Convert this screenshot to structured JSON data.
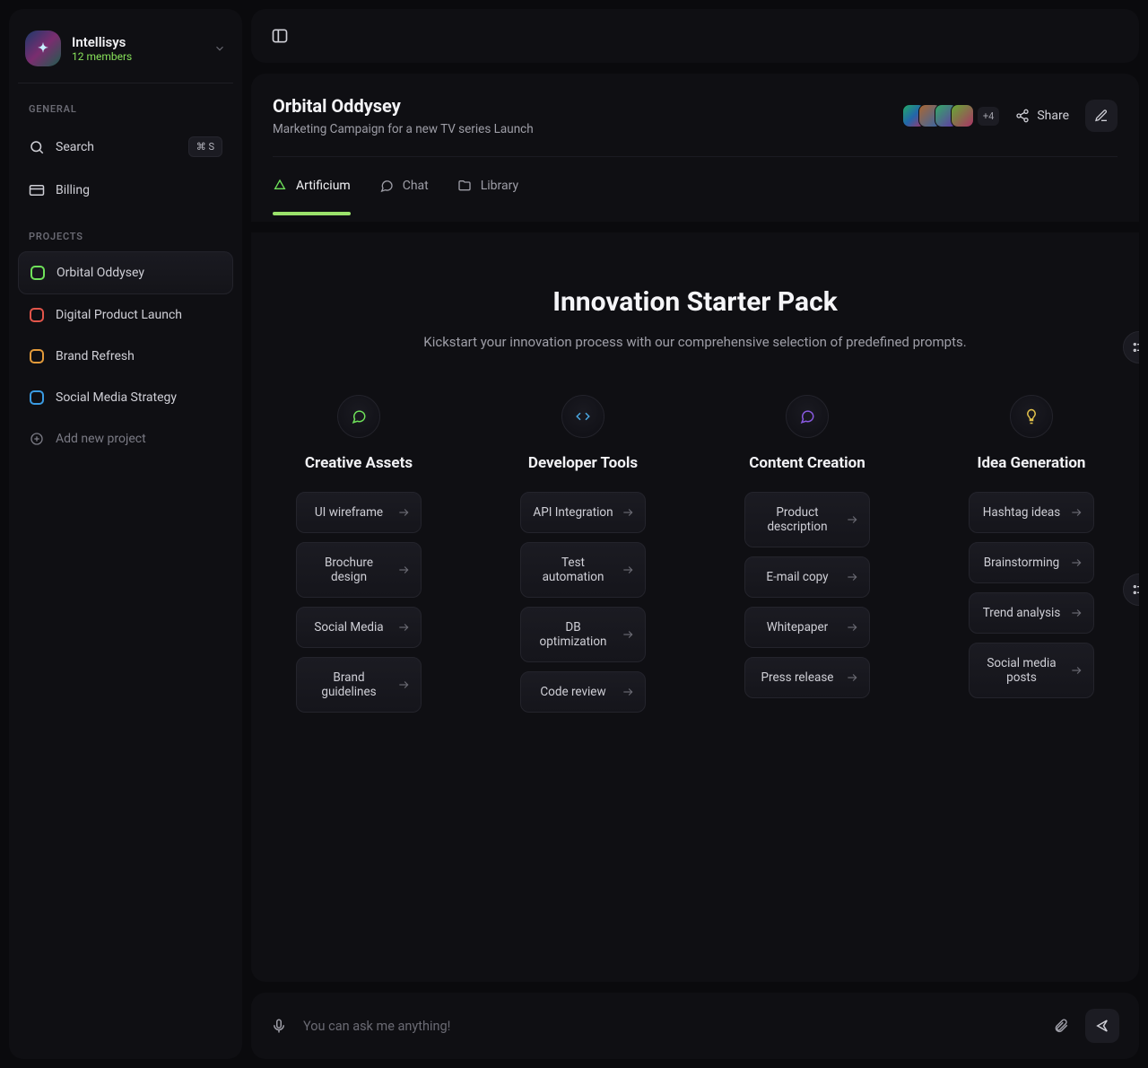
{
  "workspace": {
    "name": "Intellisys",
    "members": "12 members"
  },
  "sidebar": {
    "general_label": "GENERAL",
    "search": {
      "label": "Search",
      "shortcut": "⌘ S"
    },
    "billing": "Billing",
    "projects_label": "PROJECTS",
    "projects": [
      {
        "label": "Orbital Oddysey",
        "color": "#6fe25a",
        "active": true
      },
      {
        "label": "Digital Product Launch",
        "color": "#e2554a"
      },
      {
        "label": "Brand Refresh",
        "color": "#e29a3a"
      },
      {
        "label": "Social Media Strategy",
        "color": "#3a9be2"
      }
    ],
    "add_project": "Add new project"
  },
  "header": {
    "title": "Orbital Oddysey",
    "subtitle": "Marketing Campaign for a new TV series Launch",
    "extra_members": "+4",
    "share": "Share"
  },
  "tabs": [
    {
      "label": "Artificium",
      "active": true
    },
    {
      "label": "Chat"
    },
    {
      "label": "Library"
    }
  ],
  "hero": {
    "title": "Innovation Starter Pack",
    "subtitle": "Kickstart your innovation process with our comprehensive selection of predefined prompts."
  },
  "columns": [
    {
      "title": "Creative Assets",
      "color": "#6fe25a",
      "items": [
        "UI wireframe",
        "Brochure design",
        "Social Media",
        "Brand guidelines"
      ]
    },
    {
      "title": "Developer Tools",
      "color": "#4aa8e2",
      "items": [
        "API Integration",
        "Test automation",
        "DB optimization",
        "Code review"
      ]
    },
    {
      "title": "Content Creation",
      "color": "#8a5ae2",
      "items": [
        "Product description",
        "E-mail copy",
        "Whitepaper",
        "Press release"
      ]
    },
    {
      "title": "Idea Generation",
      "color": "#e2c14a",
      "items": [
        "Hashtag ideas",
        "Brainstorming",
        "Trend analysis",
        "Social media posts"
      ]
    }
  ],
  "prompt": {
    "placeholder": "You can ask me anything!"
  }
}
